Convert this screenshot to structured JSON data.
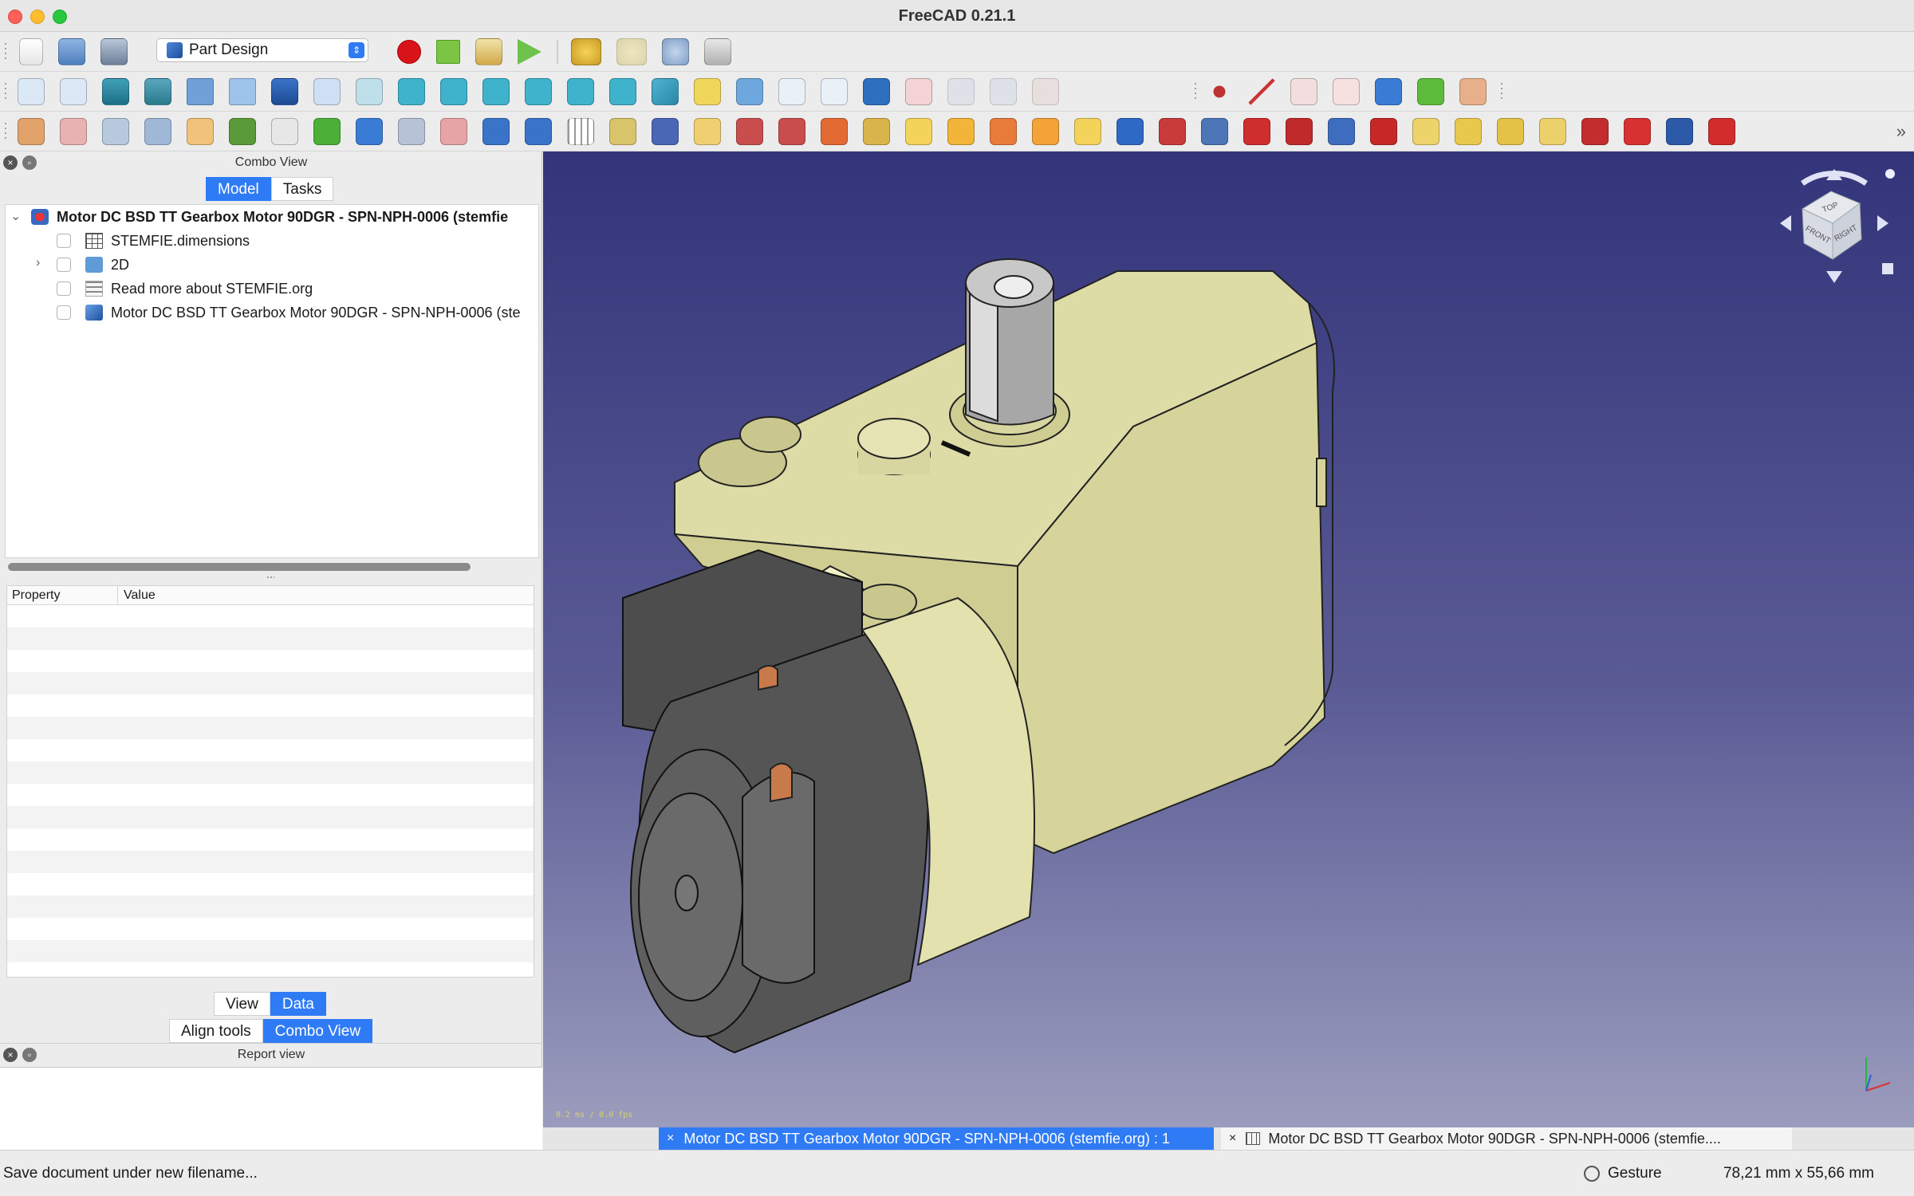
{
  "window": {
    "title": "FreeCAD 0.21.1"
  },
  "toolbar": {
    "workbench": "Part Design"
  },
  "combo_view": {
    "title": "Combo View",
    "tabs": [
      "Model",
      "Tasks"
    ],
    "tree": [
      {
        "label": "Motor DC BSD TT Gearbox Motor 90DGR - SPN-NPH-0006 (stemfie"
      },
      {
        "label": "STEMFIE.dimensions"
      },
      {
        "label": "2D"
      },
      {
        "label": "Read more about STEMFIE.org"
      },
      {
        "label": "Motor DC BSD TT Gearbox Motor 90DGR - SPN-NPH-0006 (ste"
      }
    ],
    "property_header": {
      "property": "Property",
      "value": "Value"
    },
    "view_tabs": [
      "View",
      "Data"
    ],
    "bottom_tabs": [
      "Align tools",
      "Combo View"
    ]
  },
  "report_view": {
    "title": "Report view"
  },
  "viewport": {
    "fps": "0.2 ms / 0.0 fps",
    "navcube": {
      "top": "TOP",
      "front": "FRONT",
      "right": "RIGHT"
    }
  },
  "doc_tabs": [
    {
      "label": "Motor DC BSD TT Gearbox Motor 90DGR - SPN-NPH-0006 (stemfie.org) : 1",
      "close": "×"
    },
    {
      "label": "Motor DC BSD TT Gearbox Motor 90DGR - SPN-NPH-0006 (stemfie....",
      "close": "×"
    }
  ],
  "status": {
    "message": "Save document under new filename...",
    "navigation": "Gesture",
    "dimensions": "78,21 mm x 55,66 mm"
  },
  "colors": {
    "accent": "#2f7bf5",
    "gearbox": "#d8d6a0",
    "motor": "#5a5a5a",
    "copper": "#c87a4a"
  }
}
